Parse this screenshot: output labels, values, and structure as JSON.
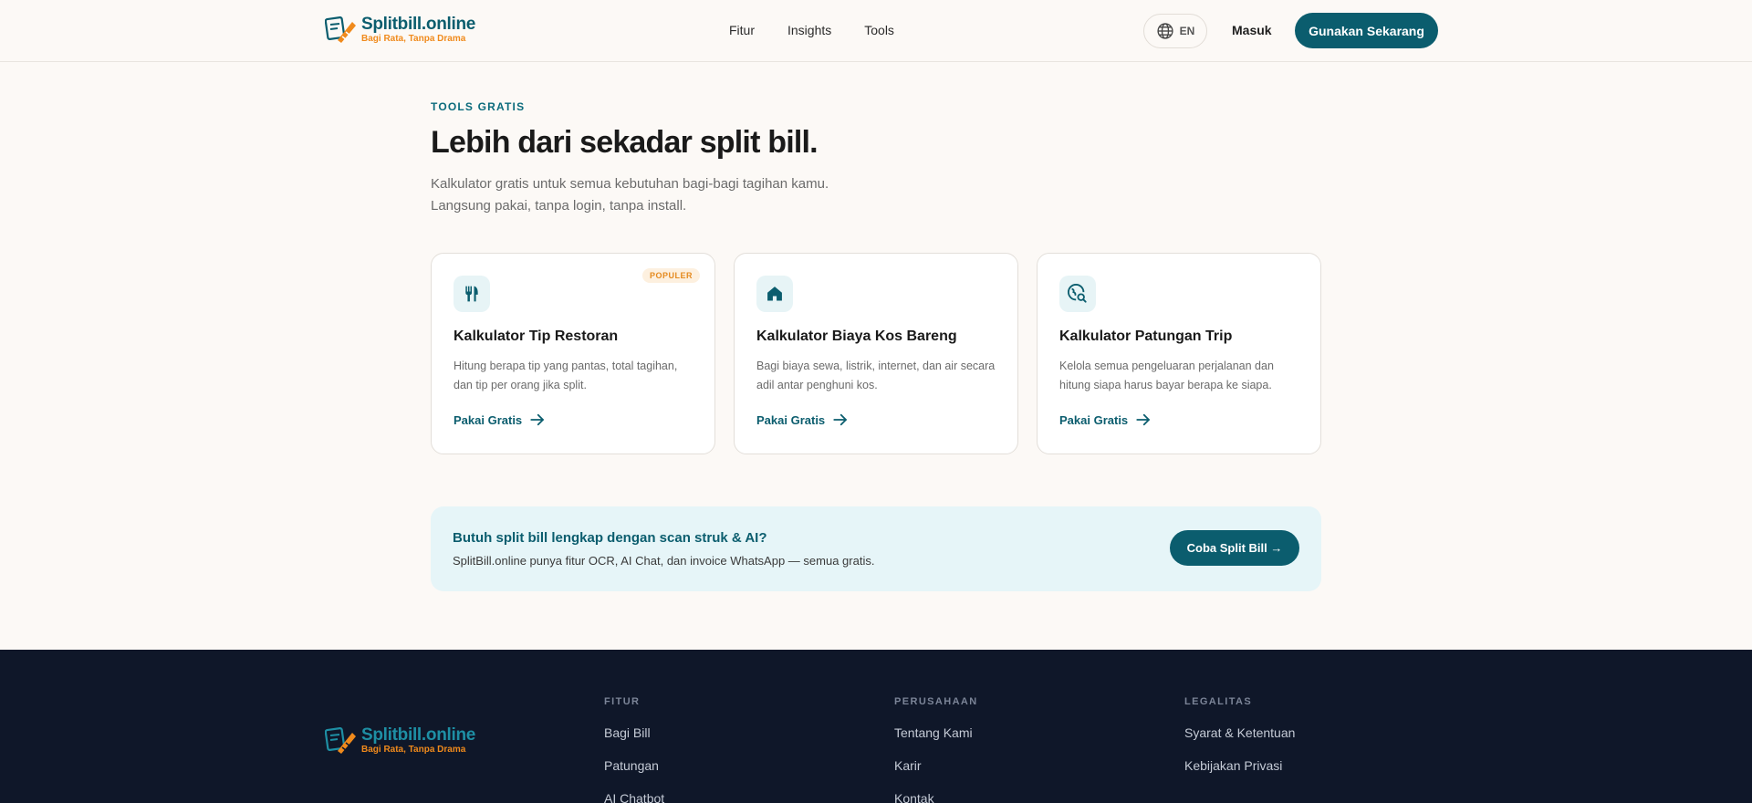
{
  "header": {
    "logo_name": "Splitbill.online",
    "logo_tagline": "Bagi Rata, Tanpa Drama",
    "nav": [
      "Fitur",
      "Insights",
      "Tools"
    ],
    "language": "EN",
    "login": "Masuk",
    "cta": "Gunakan Sekarang"
  },
  "hero": {
    "eyebrow": "TOOLS GRATIS",
    "title": "Lebih dari sekadar split bill.",
    "subtitle_line1": "Kalkulator gratis untuk semua kebutuhan bagi-bagi tagihan kamu.",
    "subtitle_line2": "Langsung pakai, tanpa login, tanpa install."
  },
  "cards": [
    {
      "icon": "utensils-icon",
      "badge": "POPULER",
      "title": "Kalkulator Tip Restoran",
      "desc": "Hitung berapa tip yang pantas, total tagihan, dan tip per orang jika split.",
      "link": "Pakai Gratis"
    },
    {
      "icon": "house-icon",
      "title": "Kalkulator Biaya Kos Bareng",
      "desc": "Bagi biaya sewa, listrik, internet, dan air secara adil antar penghuni kos.",
      "link": "Pakai Gratis"
    },
    {
      "icon": "globe-search-icon",
      "title": "Kalkulator Patungan Trip",
      "desc": "Kelola semua pengeluaran perjalanan dan hitung siapa harus bayar berapa ke siapa.",
      "link": "Pakai Gratis"
    }
  ],
  "promo": {
    "title": "Butuh split bill lengkap dengan scan struk & AI?",
    "desc": "SplitBill.online punya fitur OCR, AI Chat, dan invoice WhatsApp — semua gratis.",
    "button": "Coba Split Bill →"
  },
  "footer": {
    "columns": [
      {
        "heading": "FITUR",
        "items": [
          "Bagi Bill",
          "Patungan",
          "AI Chatbot"
        ]
      },
      {
        "heading": "PERUSAHAAN",
        "items": [
          "Tentang Kami",
          "Karir",
          "Kontak"
        ]
      },
      {
        "heading": "LEGALITAS",
        "items": [
          "Syarat & Ketentuan",
          "Kebijakan Privasi"
        ]
      }
    ]
  },
  "colors": {
    "brand": "#0b5d6e",
    "accent": "#f08a1c",
    "background": "#fcf9f6",
    "footer": "#0f1729",
    "promo_bg": "#e6f5f8"
  }
}
